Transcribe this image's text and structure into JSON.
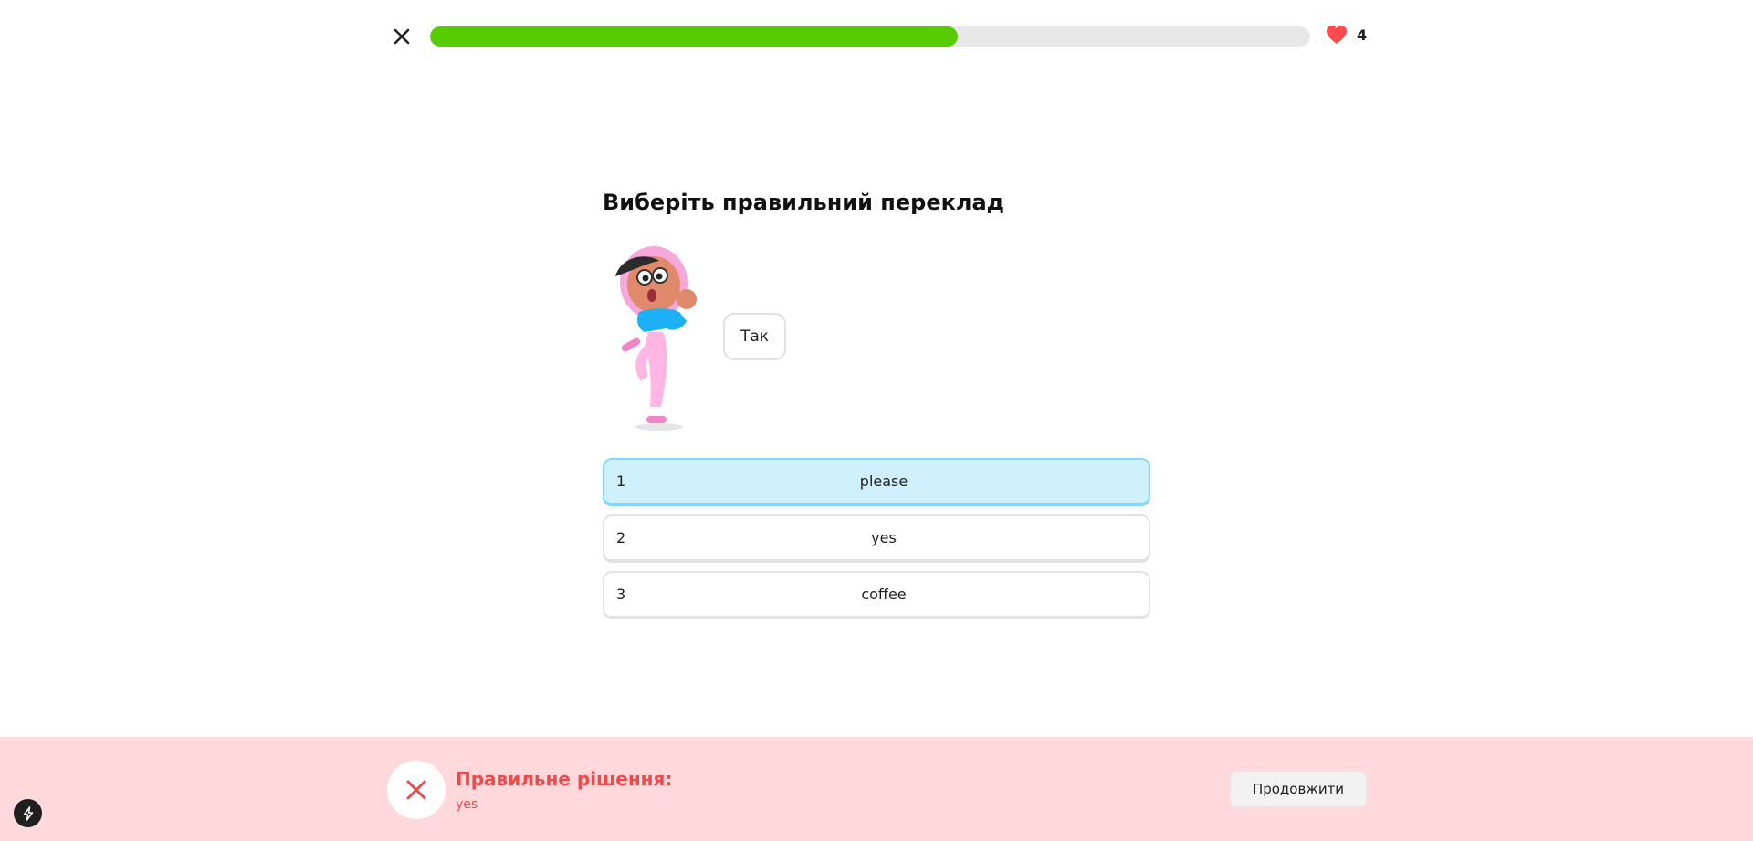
{
  "header": {
    "progress_fraction": 0.6,
    "hearts_count": "4"
  },
  "exercise": {
    "prompt": "Виберіть правильний переклад",
    "word": "Так",
    "options": [
      {
        "number": "1",
        "label": "please"
      },
      {
        "number": "2",
        "label": "yes"
      },
      {
        "number": "3",
        "label": "coffee"
      }
    ],
    "selected_index": 0
  },
  "feedback": {
    "title": "Правильне рішення:",
    "answer": "yes",
    "continue_label": "Продовжити"
  },
  "colors": {
    "progress": "#58cc02",
    "heart": "#ff4b4b",
    "feedback_bg": "#ffd9dc",
    "feedback_text": "#ea4b4b",
    "selected_option_bg": "#cff0fd"
  },
  "icons": {
    "close": "close-icon",
    "heart": "heart-icon",
    "wrong": "x-icon",
    "bolt": "bolt-icon"
  }
}
